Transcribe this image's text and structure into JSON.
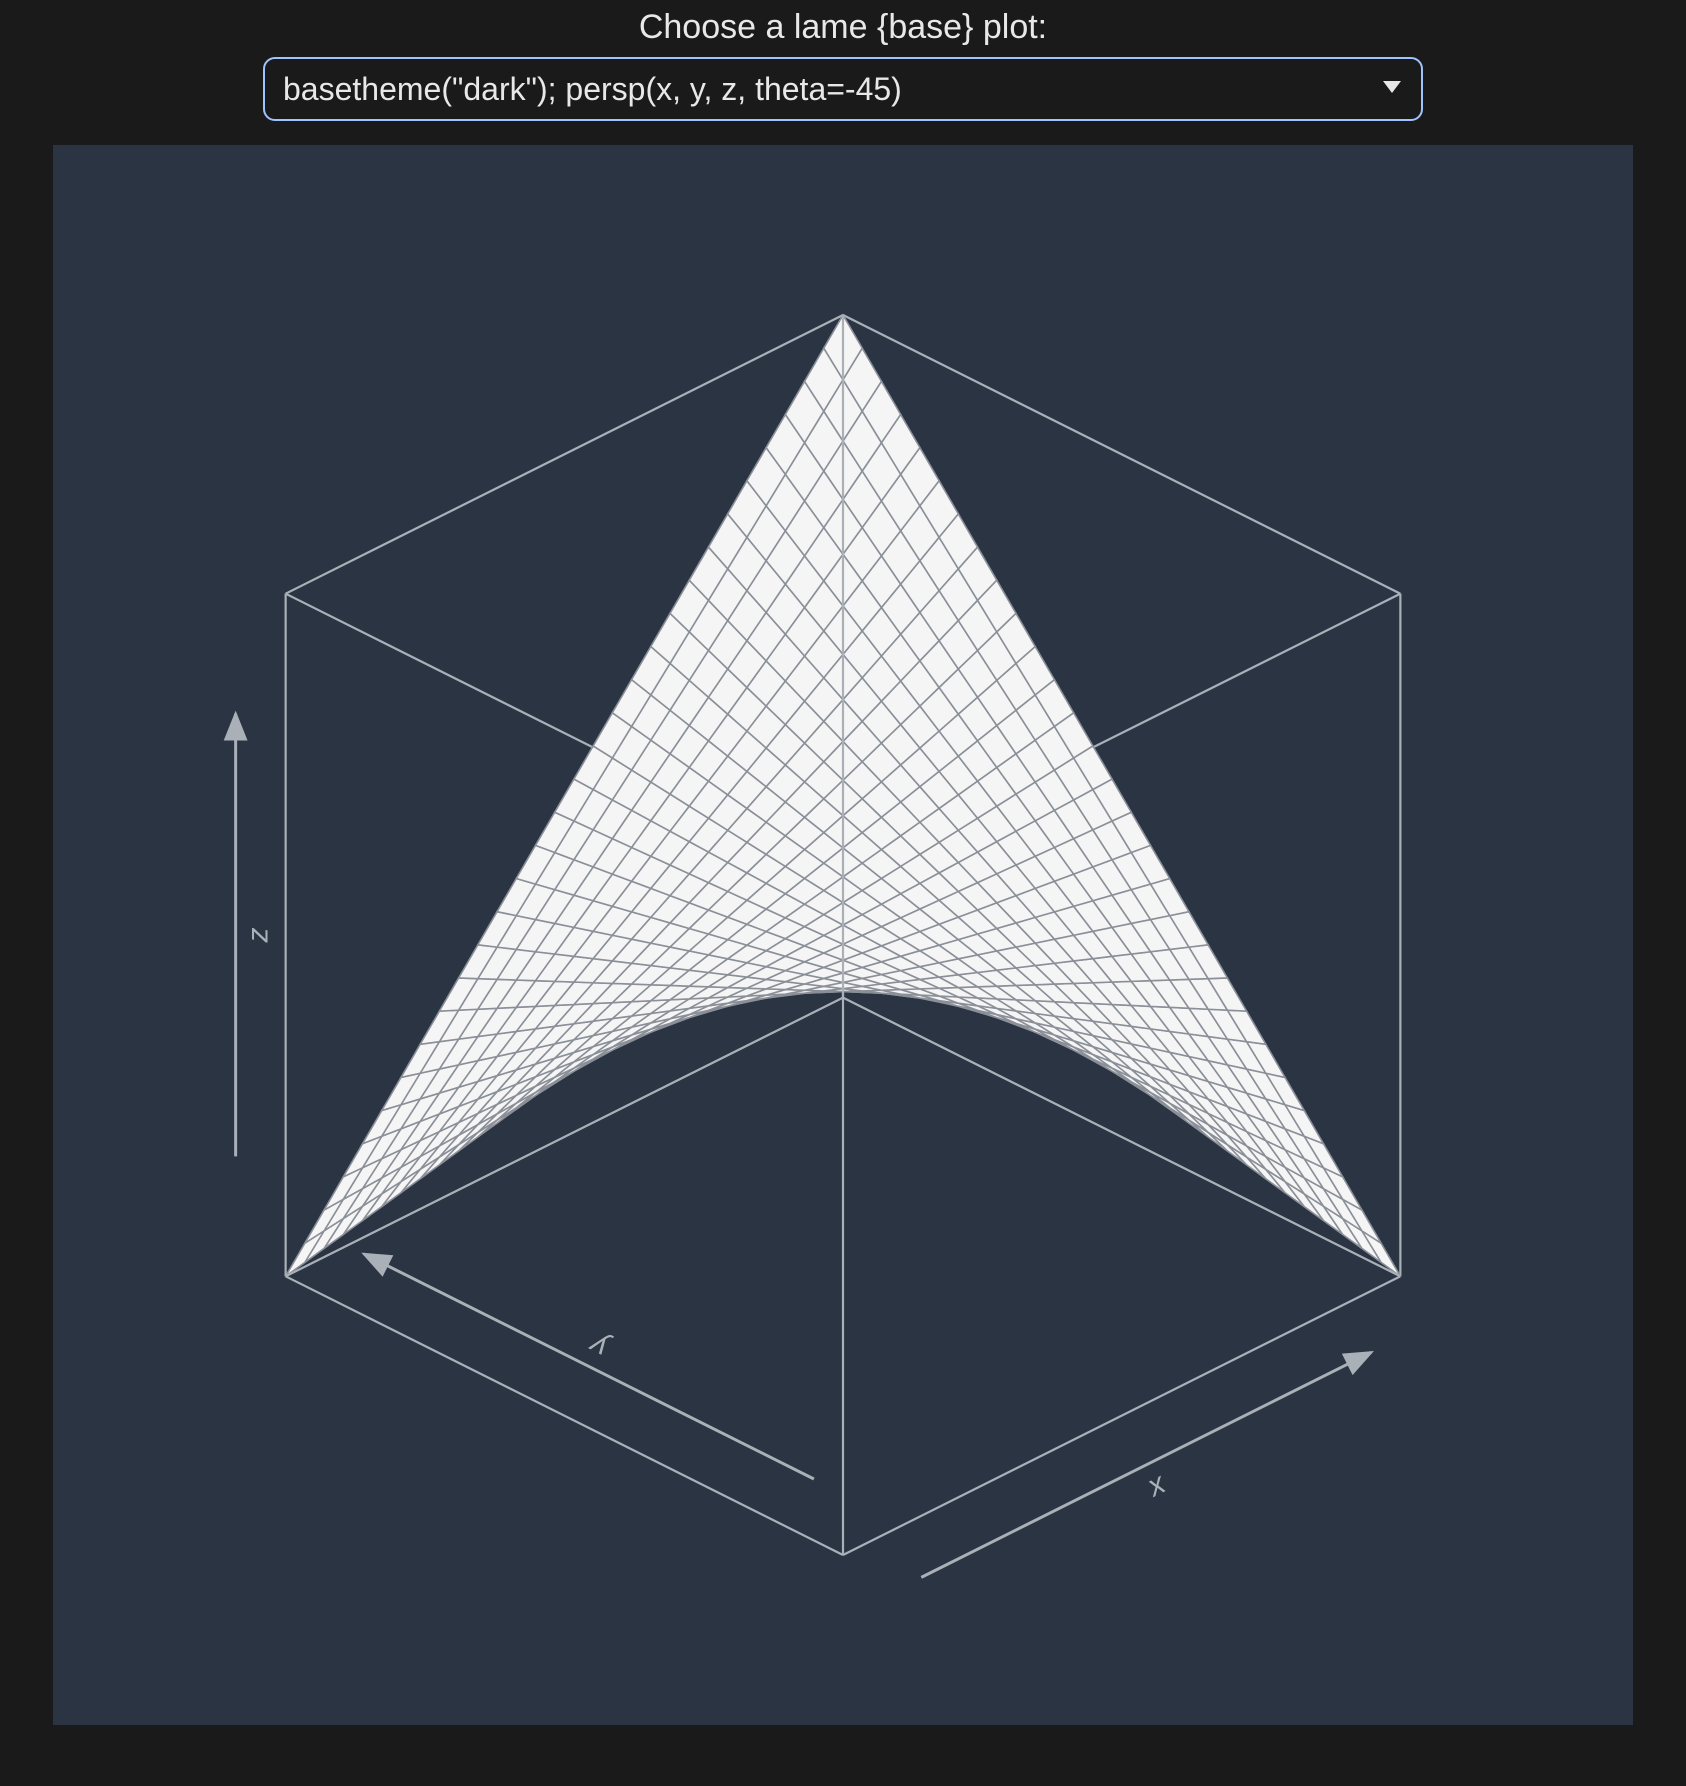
{
  "header": {
    "label": "Choose a lame {base} plot:"
  },
  "select": {
    "value": "basetheme(\"dark\"); persp(x, y, z, theta=-45)"
  },
  "chart_data": {
    "type": "surface",
    "function": "z = x * y  (saddle)",
    "persp": {
      "theta": -45,
      "phi": 30
    },
    "x": {
      "from": -1,
      "to": 1,
      "n": 30
    },
    "y": {
      "from": -1,
      "to": 1,
      "n": 30
    },
    "z_range": [
      -1,
      1
    ],
    "axis_labels": {
      "x": "x",
      "y": "y",
      "z": "z"
    },
    "colors": {
      "panel_bg": "#2b3443",
      "surface_fill": "#f5f5f5",
      "wire": "#8a8f98",
      "box": "#aab0b8"
    }
  }
}
